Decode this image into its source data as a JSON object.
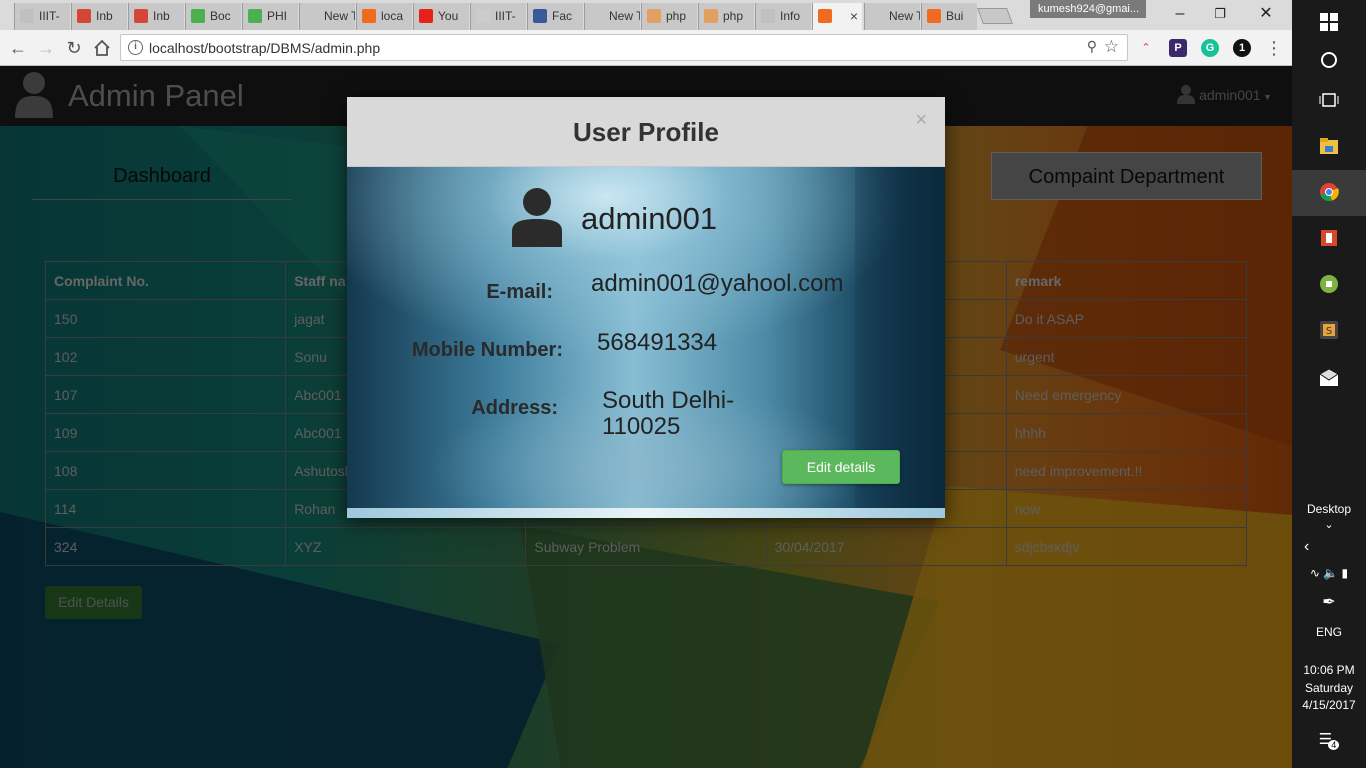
{
  "browser": {
    "tabs": [
      {
        "label": "IIIT-",
        "color": "#c0c0c0"
      },
      {
        "label": "Inb",
        "color": "#d44638"
      },
      {
        "label": "Inb",
        "color": "#d44638"
      },
      {
        "label": "Boc",
        "color": "#4caf50"
      },
      {
        "label": "PHI",
        "color": "#4caf50"
      },
      {
        "label": "New Ta",
        "color": ""
      },
      {
        "label": "loca",
        "color": "#f26b1d"
      },
      {
        "label": "You",
        "color": "#e62117"
      },
      {
        "label": "IIIT-",
        "color": "#cccccc"
      },
      {
        "label": "Fac",
        "color": "#3b5998"
      },
      {
        "label": "New Ta",
        "color": ""
      },
      {
        "label": "php",
        "color": "#e0a060"
      },
      {
        "label": "php",
        "color": "#e0a060"
      },
      {
        "label": "Info",
        "color": "#c0c0c0"
      },
      {
        "label": "",
        "color": "#f26b1d",
        "active": true
      },
      {
        "label": "New Ta",
        "color": ""
      },
      {
        "label": "Bui",
        "color": "#f26b1d"
      }
    ],
    "profile": "kumesh924@gmai...",
    "url": "localhost/bootstrap/DBMS/admin.php"
  },
  "admin_bar": {
    "title": "Admin Panel",
    "user": "admin001"
  },
  "nav": {
    "dashboard": "Dashboard",
    "complaint_department": "Compaint Department"
  },
  "table": {
    "headers": [
      "Complaint No.",
      "Staff na",
      "",
      "",
      "remark"
    ],
    "rows": [
      [
        "150",
        "jagat",
        "",
        "",
        "Do it ASAP"
      ],
      [
        "102",
        "Sonu",
        "",
        "",
        "urgent"
      ],
      [
        "107",
        "Abc001",
        "",
        "",
        "Need emergency"
      ],
      [
        "109",
        "Abc001",
        "",
        "",
        "hhhh"
      ],
      [
        "108",
        "Ashutosh",
        "",
        "",
        "need improvement.!!"
      ],
      [
        "114",
        "Rohan",
        "",
        "",
        "now"
      ],
      [
        "324",
        "XYZ",
        "Subway Problem",
        "30/04/2017",
        "sdjcbskdjv"
      ]
    ],
    "edit_button": "Edit Details"
  },
  "modal": {
    "title": "User Profile",
    "close": "×",
    "username": "admin001",
    "email_label": "E-mail:",
    "email": "admin001@yahool.com",
    "mobile_label": "Mobile Number:",
    "mobile": "568491334",
    "address_label": "Address:",
    "address": "South Delhi-110025",
    "edit_button": "Edit details"
  },
  "taskbar": {
    "desktop_label": "Desktop",
    "language": "ENG",
    "time": "10:06 PM",
    "day": "Saturday",
    "date": "4/15/2017",
    "notifications": "4"
  }
}
